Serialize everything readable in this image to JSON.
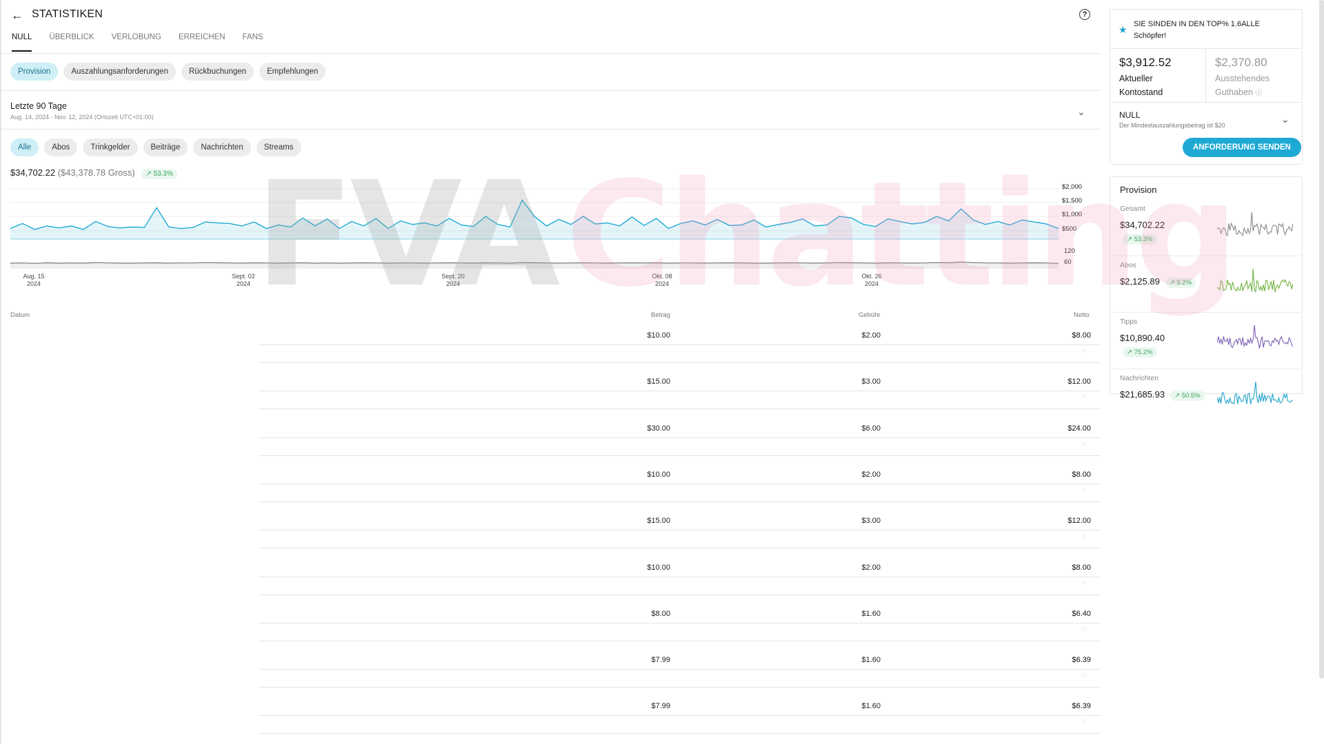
{
  "header": {
    "title": "STATISTIKEN"
  },
  "tabs": [
    "NULL",
    "ÜBERBLICK",
    "VERLOBUNG",
    "ERREICHEN",
    "FANS"
  ],
  "subtabs": [
    "Provision",
    "Auszahlungsanforderungen",
    "Rückbuchungen",
    "Empfehlungen"
  ],
  "period": {
    "title": "Letzte 90 Tage",
    "range": "Aug. 14, 2024 - Nov. 12, 2024 (Ortszeit UTC+01:00)"
  },
  "filters": [
    "Alle",
    "Abos",
    "Trinkgelder",
    "Beiträge",
    "Nachrichten",
    "Streams"
  ],
  "summary": {
    "net": "$34,702.22",
    "gross": "($43,378.78 Gross)",
    "change": "53.3%"
  },
  "chart_data": {
    "type": "line",
    "y_ticks_top": [
      "$2,000",
      "$1,500",
      "$1,000",
      "$500"
    ],
    "y_ticks_bottom": [
      "120",
      "60"
    ],
    "x_ticks": [
      {
        "label": "Aug. 15",
        "year": "2024"
      },
      {
        "label": "Sept. 02",
        "year": "2024"
      },
      {
        "label": "Sept. 20",
        "year": "2024"
      },
      {
        "label": "Okt. 08",
        "year": "2024"
      },
      {
        "label": "Okt. 26",
        "year": "2024"
      }
    ],
    "series": [
      {
        "values": [
          420,
          620,
          380,
          520,
          440,
          520,
          380,
          700,
          500,
          440,
          480,
          460,
          1250,
          480,
          420,
          460,
          680,
          640,
          620,
          520,
          680,
          420,
          560,
          480,
          840,
          520,
          800,
          420,
          700,
          520,
          820,
          420,
          720,
          580,
          640,
          520,
          820,
          560,
          500,
          900,
          580,
          480,
          1550,
          900,
          520,
          780,
          580,
          900,
          600,
          640,
          520,
          880,
          540,
          820,
          420,
          620,
          720,
          560,
          780,
          540,
          560,
          760,
          480,
          580,
          660,
          800,
          520,
          560,
          900,
          840,
          580,
          500,
          800,
          700,
          600,
          660,
          900,
          720,
          1200,
          760,
          580,
          700,
          560,
          760,
          680,
          600,
          420
        ]
      },
      {
        "values": [
          60,
          62,
          58,
          64,
          60,
          62,
          60,
          66,
          62,
          60,
          60,
          62,
          64,
          60,
          62,
          62,
          66,
          64,
          62,
          60,
          64,
          62,
          60,
          62,
          64,
          60,
          62,
          60,
          62,
          64,
          62,
          60,
          62,
          62,
          60,
          62,
          64,
          62,
          60,
          64,
          62,
          60,
          66,
          64,
          62,
          60,
          62,
          64,
          62,
          60,
          62,
          64,
          62,
          64,
          60,
          62,
          62,
          60,
          62,
          64,
          62,
          60,
          60,
          62,
          64,
          62,
          60,
          62,
          66,
          64,
          62,
          60,
          64,
          62,
          60,
          62,
          66,
          64,
          72,
          66,
          62,
          62,
          60,
          62,
          64,
          62,
          58
        ]
      }
    ]
  },
  "table": {
    "headers": {
      "date": "Datum",
      "amount": "Betrag",
      "fee": "Gebühr",
      "net": "Netto"
    },
    "rows": [
      {
        "amount": "$10.00",
        "fee": "$2.00",
        "net": "$8.00"
      },
      {
        "amount": "$15.00",
        "fee": "$3.00",
        "net": "$12.00"
      },
      {
        "amount": "$30.00",
        "fee": "$6.00",
        "net": "$24.00"
      },
      {
        "amount": "$10.00",
        "fee": "$2.00",
        "net": "$8.00"
      },
      {
        "amount": "$15.00",
        "fee": "$3.00",
        "net": "$12.00"
      },
      {
        "amount": "$10.00",
        "fee": "$2.00",
        "net": "$8.00"
      },
      {
        "amount": "$8.00",
        "fee": "$1.60",
        "net": "$6.40"
      },
      {
        "amount": "$7.99",
        "fee": "$1.60",
        "net": "$6.39"
      },
      {
        "amount": "$7.99",
        "fee": "$1.60",
        "net": "$6.39"
      }
    ]
  },
  "sidebar": {
    "top_creator": "SIE SINDEN IN DEN TOP% 1.6ALLE Schöpfer!",
    "balance": {
      "current_value": "$3,912.52",
      "current_label_1": "Aktueller",
      "current_label_2": "Kontostand",
      "pending_value": "$2,370.80",
      "pending_label_1": "Ausstehendes",
      "pending_label_2": "Guthaben"
    },
    "payout": {
      "method": "NULL",
      "note": "Der Mindestauszahlungsbetrag ist $20",
      "button": "ANFORDERUNG SENDEN"
    },
    "provision": {
      "title": "Provision",
      "items": [
        {
          "label": "Gesamt",
          "value": "$34,702.22",
          "change": "53.3%",
          "color": "#888888"
        },
        {
          "label": "Abos",
          "value": "$2,125.89",
          "change": "5.2%",
          "color": "#6fb33d"
        },
        {
          "label": "Tipps",
          "value": "$10,890.40",
          "change": "75.2%",
          "color": "#7a5fb3"
        },
        {
          "label": "Nachrichten",
          "value": "$21,685.93",
          "change": "50.5%",
          "color": "#1da2c8"
        }
      ]
    }
  },
  "watermark": {
    "text_1": "FVA",
    "text_2": "Chatting"
  }
}
